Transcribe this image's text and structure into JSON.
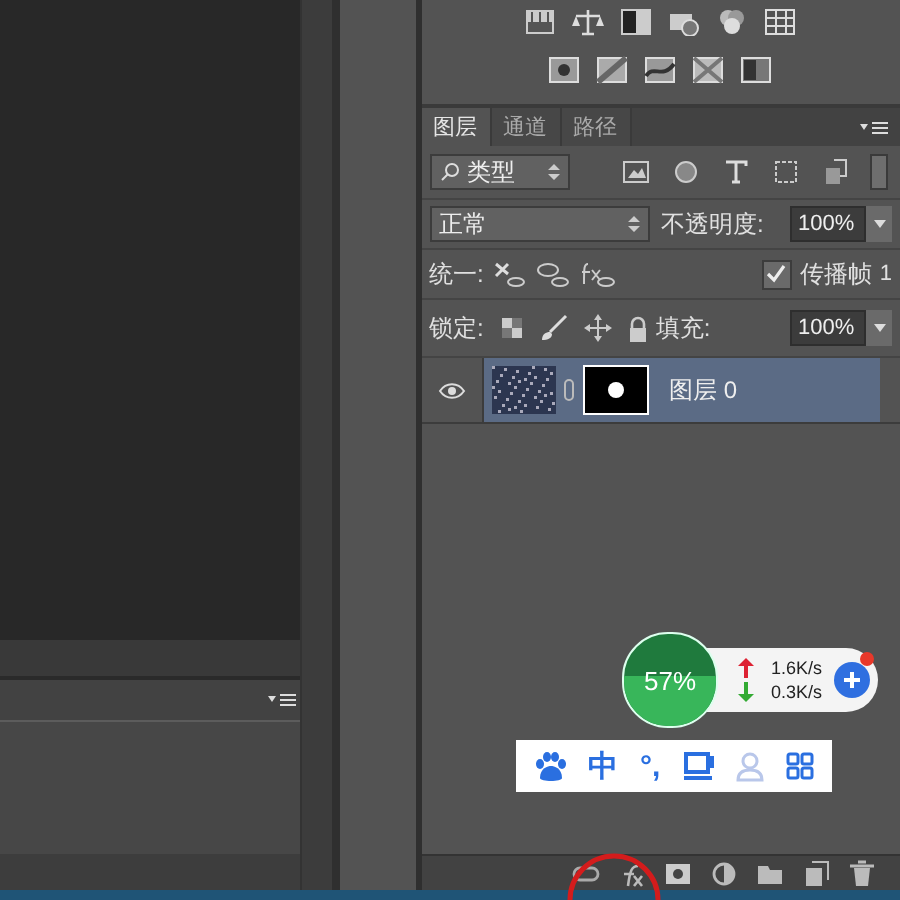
{
  "layers_panel": {
    "tabs": [
      {
        "label": "图层",
        "selected": true
      },
      {
        "label": "通道",
        "selected": false
      },
      {
        "label": "路径",
        "selected": false
      }
    ],
    "filter": {
      "value": "类型"
    },
    "blend_mode": "正常",
    "opacity_label": "不透明度:",
    "opacity": "100%",
    "unify_label": "统一:",
    "propagate": {
      "label": "传播帧",
      "checked": true
    },
    "frame_number": "1",
    "lock_label": "锁定:",
    "fill_label": "填充:",
    "fill": "100%",
    "layers": [
      {
        "name": "图层 0",
        "visible": true,
        "selected": true
      }
    ]
  },
  "net_widget": {
    "percent": "57%",
    "upload": "1.6K/s",
    "download": "0.3K/s"
  },
  "ime_bar": {
    "labels": [
      "中",
      "°,"
    ]
  }
}
